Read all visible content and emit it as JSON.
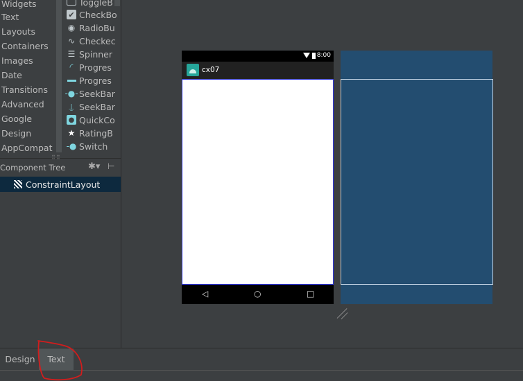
{
  "palette": {
    "categories": [
      "Widgets",
      "Text",
      "Layouts",
      "Containers",
      "Images",
      "Date",
      "Transitions",
      "Advanced",
      "Google",
      "Design",
      "AppCompat"
    ],
    "widgets": [
      {
        "label": "ToggleB",
        "icon": "toggle-button-icon"
      },
      {
        "label": "CheckBo",
        "icon": "checkbox-icon"
      },
      {
        "label": "RadioBu",
        "icon": "radio-button-icon"
      },
      {
        "label": "Checkec",
        "icon": "checked-textview-icon"
      },
      {
        "label": "Spinner",
        "icon": "spinner-icon"
      },
      {
        "label": "Progres",
        "icon": "progress-circle-icon"
      },
      {
        "label": "Progres",
        "icon": "progress-bar-icon"
      },
      {
        "label": "SeekBar",
        "icon": "seekbar-icon"
      },
      {
        "label": "SeekBar",
        "icon": "seekbar-discrete-icon"
      },
      {
        "label": "QuickCo",
        "icon": "quick-contact-icon"
      },
      {
        "label": "RatingB",
        "icon": "star-icon"
      },
      {
        "label": "Switch",
        "icon": "switch-icon"
      }
    ]
  },
  "component_tree": {
    "title": "Component Tree",
    "root": "ConstraintLayout"
  },
  "design": {
    "status_time": "8:00",
    "app_title": "cx07"
  },
  "tabs": {
    "design": "Design",
    "text": "Text"
  },
  "colors": {
    "blueprint": "#234d70",
    "selection": "#0d293e",
    "annotation": "#d11d1d"
  }
}
